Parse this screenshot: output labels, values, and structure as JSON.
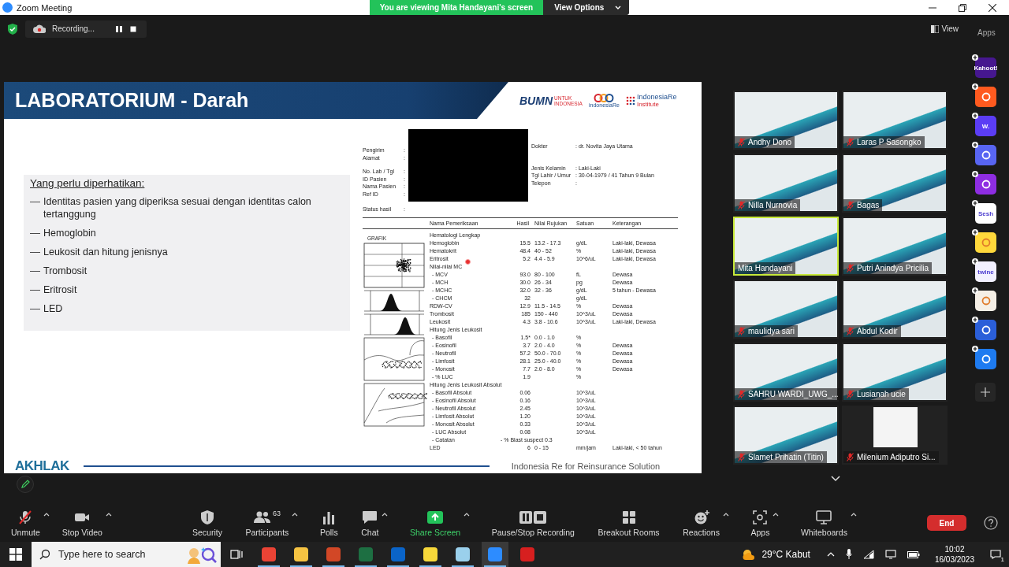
{
  "window": {
    "title": "Zoom Meeting"
  },
  "banner": {
    "text": "You are viewing Mita Handayani's screen",
    "options": "View Options"
  },
  "recording": {
    "label": "Recording..."
  },
  "view_button": {
    "label": "View"
  },
  "apps_header": "Apps",
  "slide": {
    "title": "LABORATORIUM - Darah",
    "logos": {
      "bumn": "BUMN",
      "bumn_tagline": "UNTUK INDONESIA",
      "indonesiare": "indonesiaRe",
      "institute_name": "IndonesiaRe",
      "institute_sub": "Institute"
    },
    "checklist": {
      "heading": "Yang perlu diperhatikan:",
      "items": [
        {
          "marker": "—",
          "text": "Identitas pasien yang diperiksa sesuai dengan identitas calon tertanggung"
        },
        {
          "marker": "—",
          "text": "Hemoglobin"
        },
        {
          "marker": "—",
          "text": "Leukosit dan hitung jenisnya"
        },
        {
          "marker": "—",
          "text": "Trombosit"
        },
        {
          "marker": "—",
          "text": "Eritrosit"
        },
        {
          "marker": "—",
          "text": "LED"
        }
      ]
    },
    "report": {
      "left_groups": [
        [
          {
            "label": "Pengirim",
            "value": ":"
          },
          {
            "label": "Alamat",
            "value": ":"
          }
        ],
        [
          {
            "label": "No. Lab / Tgl",
            "value": ":"
          },
          {
            "label": "ID Pasien",
            "value": ":"
          },
          {
            "label": "Nama Pasien",
            "value": ":"
          },
          {
            "label": "Ref ID",
            "value": ":"
          }
        ]
      ],
      "status": {
        "label": "Status hasil",
        "value": ":"
      },
      "right_groups": [
        [
          {
            "label": "Dokter",
            "value": ": dr. Novita Jaya Utama"
          }
        ],
        [
          {
            "label": "Jenis Kelamin",
            "value": ": Laki-Laki"
          },
          {
            "label": "Tgl Lahir / Umur",
            "value": ": 30-04-1979 / 41 Tahun  9 Bulan"
          },
          {
            "label": "Telepon",
            "value": ":"
          }
        ]
      ],
      "columns": [
        "Nama Pemeriksaan",
        "Hasil",
        "Nilai Rujukan",
        "Satuan",
        "Keterangan"
      ],
      "graph_label": "GRAFIK",
      "rows": [
        {
          "name": "Hematologi Lengkap"
        },
        {
          "name": "Hemoglobin",
          "result": "15.5",
          "range": "13.2 - 17.3",
          "unit": "g/dL",
          "remark": "Laki-laki, Dewasa"
        },
        {
          "name": "Hematokrit",
          "result": "48.4",
          "range": "40 - 52",
          "unit": "%",
          "remark": "Laki-laki, Dewasa"
        },
        {
          "name": "Eritrosit",
          "result": "5.2",
          "range": "4.4 - 5.9",
          "unit": "10^6/uL",
          "remark": "Laki-laki, Dewasa"
        },
        {
          "name": "Nilai-nilai MC",
          "children": [
            {
              "name": "- MCV",
              "result": "93.0",
              "range": "80 - 100",
              "unit": "fL",
              "remark": "Dewasa"
            },
            {
              "name": "- MCH",
              "result": "30.0",
              "range": "26 - 34",
              "unit": "pg",
              "remark": "Dewasa"
            },
            {
              "name": "- MCHC",
              "result": "32.0",
              "range": "32 - 36",
              "unit": "g/dL",
              "remark": "5 tahun - Dewasa"
            },
            {
              "name": "- CHCM",
              "result": "32",
              "unit": "g/dL"
            }
          ]
        },
        {
          "name": "RDW-CV",
          "result": "12.9",
          "range": "11.5 - 14.5",
          "unit": "%",
          "remark": "Dewasa"
        },
        {
          "name": "Trombosit",
          "result": "185",
          "range": "150 - 440",
          "unit": "10^3/uL",
          "remark": "Dewasa"
        },
        {
          "name": "Leukosit",
          "result": "4.3",
          "range": "3.8 - 10.6",
          "unit": "10^3/uL",
          "remark": "Laki-laki, Dewasa"
        },
        {
          "name": "Hitung Jenis Leukosit",
          "children": [
            {
              "name": "- Basofil",
              "result": "1.5*",
              "range": "0.0 - 1.0",
              "unit": "%"
            },
            {
              "name": "- Eosinofil",
              "result": "3.7",
              "range": "2.0 - 4.0",
              "unit": "%",
              "remark": "Dewasa"
            },
            {
              "name": "- Neutrofil",
              "result": "57.2",
              "range": "50.0 - 70.0",
              "unit": "%",
              "remark": "Dewasa"
            },
            {
              "name": "- Limfosit",
              "result": "28.1",
              "range": "25.0 - 40.0",
              "unit": "%",
              "remark": "Dewasa"
            },
            {
              "name": "- Monosit",
              "result": "7.7",
              "range": "2.0 - 8.0",
              "unit": "%",
              "remark": "Dewasa"
            },
            {
              "name": "- % LUC",
              "result": "1.9",
              "unit": "%"
            }
          ]
        },
        {
          "name": "Hitung Jenis Leukosit Absolut",
          "children": [
            {
              "name": "- Basofil Absolut",
              "result": "0.06",
              "unit": "10^3/uL"
            },
            {
              "name": "- Eosinofil Absolut",
              "result": "0.16",
              "unit": "10^3/uL"
            },
            {
              "name": "- Neutrofil Absolut",
              "result": "2.45",
              "unit": "10^3/uL"
            },
            {
              "name": "- Limfosit Absolut",
              "result": "1.20",
              "unit": "10^3/uL"
            },
            {
              "name": "- Monosit Absolut",
              "result": "0.33",
              "unit": "10^3/uL"
            },
            {
              "name": "- LUC Absolut",
              "result": "0.08",
              "unit": "10^3/uL"
            },
            {
              "name": "- Catatan",
              "comment": "- % Blast suspect 0.3"
            }
          ]
        },
        {
          "name": "LED",
          "result": "6",
          "range": "0 - 15",
          "unit": "mm/jam",
          "remark": "Laki-laki, < 50 tahun"
        }
      ]
    },
    "footer": {
      "logo": "AKHLAK",
      "tagline": "Indonesia Re for Reinsurance Solution"
    }
  },
  "participants": [
    {
      "name": "Andhy Dono",
      "muted": true,
      "speaking": false,
      "kind": "camera"
    },
    {
      "name": "Laras P Sasongko",
      "muted": true,
      "speaking": false,
      "kind": "camera"
    },
    {
      "name": "Nilla Nurnovia",
      "muted": true,
      "speaking": false,
      "kind": "camera"
    },
    {
      "name": "Bagas",
      "muted": true,
      "speaking": false,
      "kind": "camera"
    },
    {
      "name": "Mita Handayani",
      "muted": false,
      "speaking": true,
      "kind": "camera"
    },
    {
      "name": "Putri Anindya Pricilia",
      "muted": true,
      "speaking": false,
      "kind": "camera"
    },
    {
      "name": "maulidya sari",
      "muted": true,
      "speaking": false,
      "kind": "camera"
    },
    {
      "name": "Abdul Kodir",
      "muted": true,
      "speaking": false,
      "kind": "camera"
    },
    {
      "name": "SAHRU WARDI_UWG_...",
      "muted": true,
      "speaking": false,
      "kind": "camera"
    },
    {
      "name": "Lusianah ucie",
      "muted": true,
      "speaking": false,
      "kind": "camera"
    },
    {
      "name": "Slamet Prihatin (Titin)",
      "muted": true,
      "speaking": false,
      "kind": "camera"
    },
    {
      "name": "Milenium Adiputro Si...",
      "muted": true,
      "speaking": false,
      "kind": "framed"
    }
  ],
  "apps": [
    {
      "label": "Kahoot!",
      "color": "#46178f"
    },
    {
      "color": "#ff5a1f"
    },
    {
      "label": "W.",
      "color": "#5b3df5"
    },
    {
      "color": "#5865f2"
    },
    {
      "color": "#8e2de2"
    },
    {
      "label": "Sesh",
      "color": "#ffffff"
    },
    {
      "color": "#ffd83b"
    },
    {
      "label": "twine",
      "color": "#f2f0ff"
    },
    {
      "color": "#f5efe6"
    },
    {
      "color": "#2b5fd9"
    },
    {
      "color": "#1e7bf0"
    }
  ],
  "toolbar": [
    {
      "label": "Unmute",
      "kind": "microphone",
      "caret": true,
      "highlight": false
    },
    {
      "label": "Stop Video",
      "kind": "camera",
      "caret": true,
      "highlight": false
    },
    {
      "label": "Security",
      "kind": "shield",
      "caret": false,
      "highlight": false
    },
    {
      "label": "Participants",
      "kind": "people",
      "count": "63",
      "caret": true,
      "highlight": false
    },
    {
      "label": "Polls",
      "kind": "poll",
      "caret": false,
      "highlight": false
    },
    {
      "label": "Chat",
      "kind": "chat",
      "caret": true,
      "highlight": false
    },
    {
      "label": "Share Screen",
      "kind": "share",
      "caret": true,
      "highlight": true
    },
    {
      "label": "Pause/Stop Recording",
      "kind": "recording",
      "caret": false,
      "highlight": false
    },
    {
      "label": "Breakout Rooms",
      "kind": "rooms",
      "caret": false,
      "highlight": false
    },
    {
      "label": "Reactions",
      "kind": "reactions",
      "caret": true,
      "highlight": false
    },
    {
      "label": "Apps",
      "kind": "apps",
      "caret": true,
      "highlight": false
    },
    {
      "label": "Whiteboards",
      "kind": "whiteboard",
      "caret": true,
      "highlight": false
    }
  ],
  "end_button": "End",
  "taskbar": {
    "search_placeholder": "Type here to search",
    "apps": [
      {
        "color": "#ea4335",
        "running": true,
        "selected": false
      },
      {
        "color": "#f6c342",
        "running": true,
        "selected": false
      },
      {
        "color": "#d24726",
        "running": true,
        "selected": false
      },
      {
        "color": "#1d6f42",
        "running": true,
        "selected": false
      },
      {
        "color": "#0a64c8",
        "running": true,
        "selected": false
      },
      {
        "color": "#f7d83a",
        "running": true,
        "selected": false
      },
      {
        "color": "#9ad0ec",
        "running": true,
        "selected": false
      },
      {
        "color": "#2d8cff",
        "running": true,
        "selected": true
      },
      {
        "color": "#d71f1f",
        "running": false,
        "selected": false
      }
    ],
    "weather": "29°C Kabut",
    "time": "10:02",
    "date": "16/03/2023",
    "notifications": "1"
  }
}
